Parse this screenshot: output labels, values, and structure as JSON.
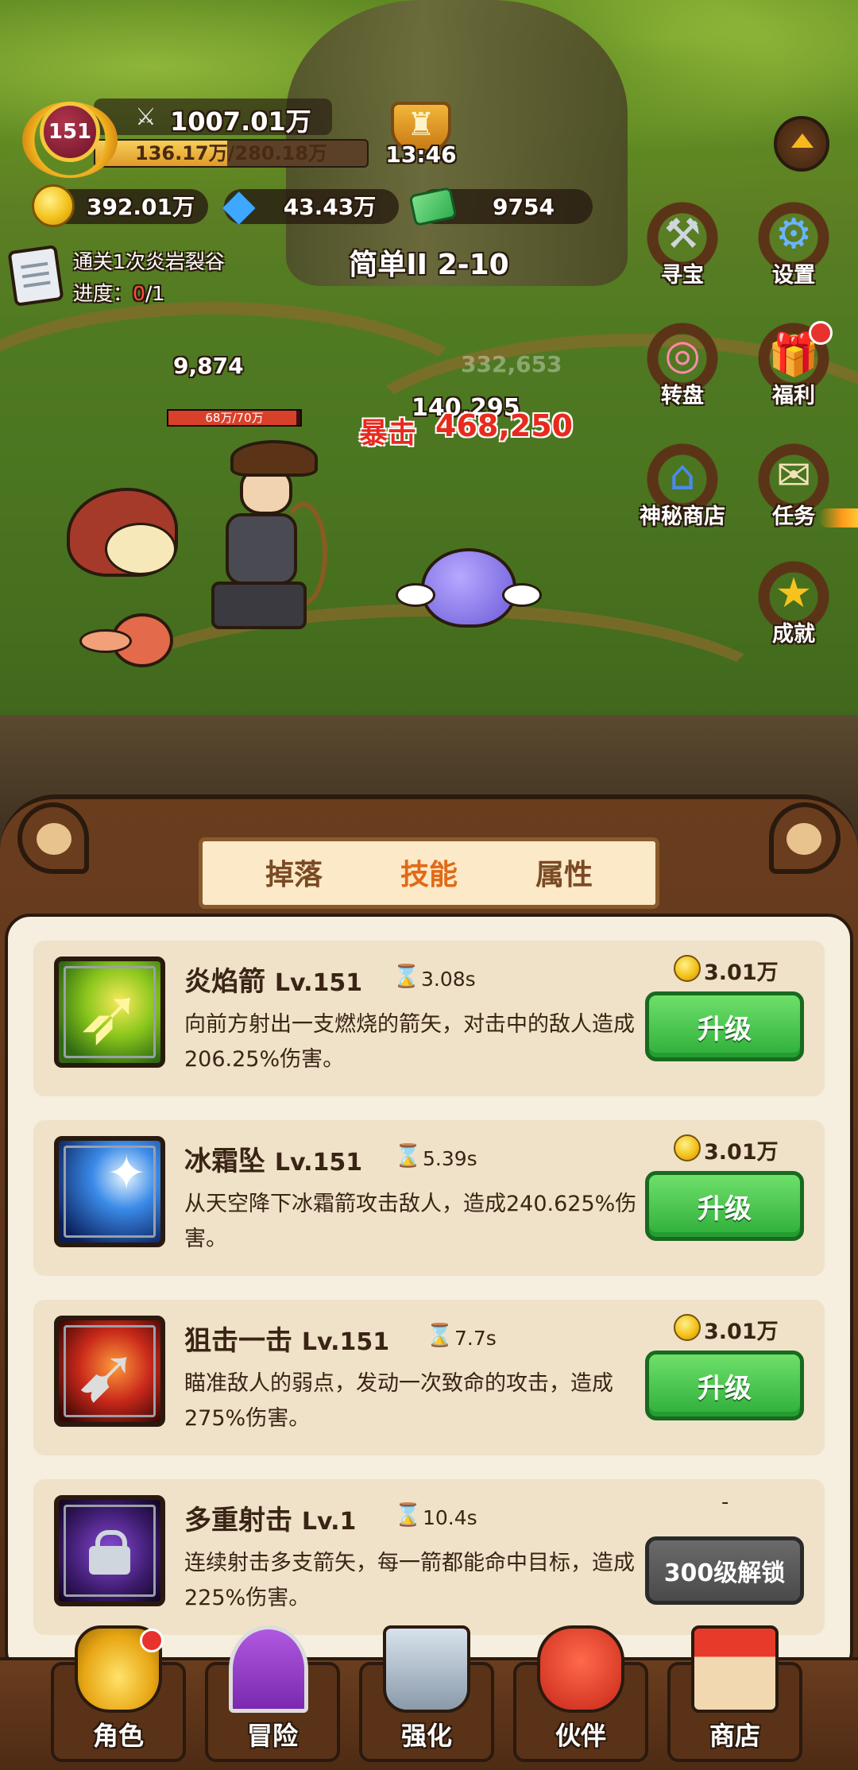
{
  "hud": {
    "level": "151",
    "power": "1007.01万",
    "exp_text": "136.17万/280.18万",
    "exp_fraction": 0.486,
    "timer": "13:46",
    "currencies": {
      "gold": "392.01万",
      "diamond": "43.43万",
      "cash": "9754"
    }
  },
  "quest": {
    "title": "通关1次炎岩裂谷",
    "progress_label": "进度：",
    "progress_current": "0",
    "progress_total": "/1"
  },
  "stage": {
    "title": "简单II 2-10"
  },
  "side_menu": [
    {
      "label": "寻宝",
      "icon": "hammer-icon"
    },
    {
      "label": "设置",
      "icon": "gear-icon"
    },
    {
      "label": "转盘",
      "icon": "wheel-icon"
    },
    {
      "label": "福利",
      "icon": "gift-icon",
      "badge": true
    },
    {
      "label": "神秘商店",
      "icon": "store-icon"
    },
    {
      "label": "任务",
      "icon": "scroll-icon"
    },
    {
      "label": "成就",
      "icon": "star-icon"
    }
  ],
  "battle": {
    "ally_damage": "9,874",
    "faded_damage": "332,653",
    "enemy_damage": "140,295",
    "crit_label": "暴击",
    "crit_value": "468,250",
    "hero_hp": "68万/70万",
    "hero_hp_fraction": 0.971
  },
  "tabs": [
    {
      "label": "掉落",
      "active": false
    },
    {
      "label": "技能",
      "active": true
    },
    {
      "label": "属性",
      "active": false
    }
  ],
  "skills": [
    {
      "name": "炎焰箭",
      "level": "Lv.151",
      "cooldown": "3.08s",
      "description": "向前方射出一支燃烧的箭矢，对击中的敌人造成206.25%伤害。",
      "cost": "3.01万",
      "button": "升级",
      "icon": "fire-arrow-icon"
    },
    {
      "name": "冰霜坠",
      "level": "Lv.151",
      "cooldown": "5.39s",
      "description": "从天空降下冰霜箭攻击敌人，造成240.625%伤害。",
      "cost": "3.01万",
      "button": "升级",
      "icon": "frost-arrow-icon"
    },
    {
      "name": "狙击一击",
      "level": "Lv.151",
      "cooldown": "7.7s",
      "description": "瞄准敌人的弱点，发动一次致命的攻击，造成275%伤害。",
      "cost": "3.01万",
      "button": "升级",
      "icon": "snipe-arrow-icon"
    },
    {
      "name": "多重射击",
      "level": "Lv.1",
      "cooldown": "10.4s",
      "description": "连续射击多支箭矢，每一箭都能命中目标，造成225%伤害。",
      "cost": "-",
      "button": "300级解锁",
      "icon": "multi-shot-icon",
      "locked": true
    }
  ],
  "bottom_nav": [
    {
      "label": "角色",
      "icon": "role-icon",
      "badge": true
    },
    {
      "label": "冒险",
      "icon": "adventure-portal-icon"
    },
    {
      "label": "强化",
      "icon": "anvil-icon"
    },
    {
      "label": "伙伴",
      "icon": "partner-icon"
    },
    {
      "label": "商店",
      "icon": "shop-icon"
    }
  ],
  "colors": {
    "upgrade_green": "#2eae3a",
    "crit_red": "#e82a1e",
    "active_tab": "#e06a18",
    "panel_cream": "#f6eedf"
  }
}
